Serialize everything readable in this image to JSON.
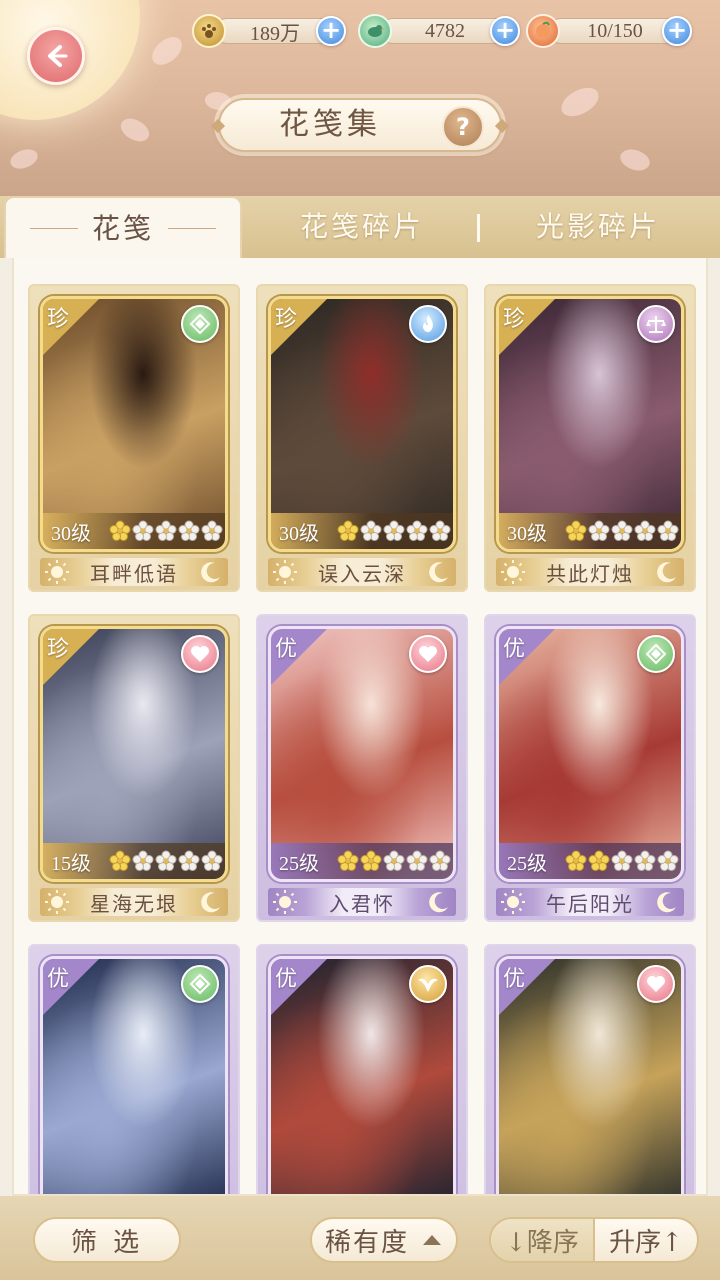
{
  "header": {
    "title": "花笺集",
    "help_icon": "question-icon",
    "back_icon": "back-arrow-icon",
    "resources": [
      {
        "name": "paw-coin",
        "value": "189万",
        "icon": "paw-coin-icon"
      },
      {
        "name": "bird-gem",
        "value": "4782",
        "icon": "bird-gem-icon"
      },
      {
        "name": "stamina",
        "value": "10/150",
        "icon": "peach-bun-icon"
      }
    ]
  },
  "tabs": [
    {
      "label": "花笺",
      "active": true
    },
    {
      "label": "花笺碎片",
      "active": false
    },
    {
      "label": "光影碎片",
      "active": false
    }
  ],
  "cards": [
    {
      "rarity": "珍",
      "level": "30级",
      "stars": 1,
      "name": "耳畔低语",
      "element": "green-diamond-icon",
      "tier": "gold"
    },
    {
      "rarity": "珍",
      "level": "30级",
      "stars": 1,
      "name": "误入云深",
      "element": "blue-flame-icon",
      "tier": "gold"
    },
    {
      "rarity": "珍",
      "level": "30级",
      "stars": 1,
      "name": "共此灯烛",
      "element": "purple-scale-icon",
      "tier": "gold"
    },
    {
      "rarity": "珍",
      "level": "15级",
      "stars": 1,
      "name": "星海无垠",
      "element": "pink-heart-icon",
      "tier": "gold"
    },
    {
      "rarity": "优",
      "level": "25级",
      "stars": 2,
      "name": "入君怀",
      "element": "pink-heart-icon",
      "tier": "purple"
    },
    {
      "rarity": "优",
      "level": "25级",
      "stars": 2,
      "name": "午后阳光",
      "element": "green-diamond-icon",
      "tier": "purple"
    },
    {
      "rarity": "优",
      "level": "",
      "stars": 0,
      "name": "",
      "element": "green-diamond-icon",
      "tier": "purple"
    },
    {
      "rarity": "优",
      "level": "",
      "stars": 0,
      "name": "",
      "element": "gold-bird-icon",
      "tier": "purple"
    },
    {
      "rarity": "优",
      "level": "",
      "stars": 0,
      "name": "",
      "element": "pink-heart-icon",
      "tier": "purple"
    }
  ],
  "bottom": {
    "filter_label": "筛 选",
    "rarity_label": "稀有度",
    "desc_label": "↓降序",
    "asc_label": "升序↑"
  },
  "colors": {
    "gold_tier": "#d8b054",
    "purple_tier": "#a487cb",
    "text_brown": "#6b5344",
    "plus_blue": "#5f9fe8"
  }
}
